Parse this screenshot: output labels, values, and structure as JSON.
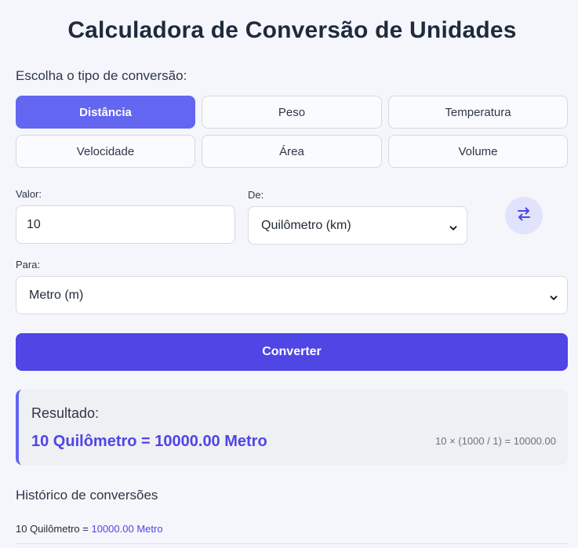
{
  "title": "Calculadora de Conversão de Unidades",
  "type_section": {
    "label": "Escolha o tipo de conversão:",
    "options": [
      {
        "label": "Distância",
        "active": true
      },
      {
        "label": "Peso",
        "active": false
      },
      {
        "label": "Temperatura",
        "active": false
      },
      {
        "label": "Velocidade",
        "active": false
      },
      {
        "label": "Área",
        "active": false
      },
      {
        "label": "Volume",
        "active": false
      }
    ]
  },
  "form": {
    "valor_label": "Valor:",
    "valor_value": "10",
    "de_label": "De:",
    "de_value": "Quilômetro (km)",
    "para_label": "Para:",
    "para_value": "Metro (m)",
    "swap_icon": "swap-arrows-icon",
    "convert_label": "Converter"
  },
  "result": {
    "title": "Resultado:",
    "main": "10 Quilômetro = 10000.00 Metro",
    "formula": "10 × (1000 / 1) = 10000.00"
  },
  "history": {
    "title": "Histórico de conversões",
    "items": [
      {
        "from": "10 Quilômetro =",
        "to": "10000.00 Metro"
      }
    ]
  },
  "colors": {
    "accent": "#6366f1",
    "primary_button": "#4f46e5",
    "background": "#f5f6fc"
  }
}
